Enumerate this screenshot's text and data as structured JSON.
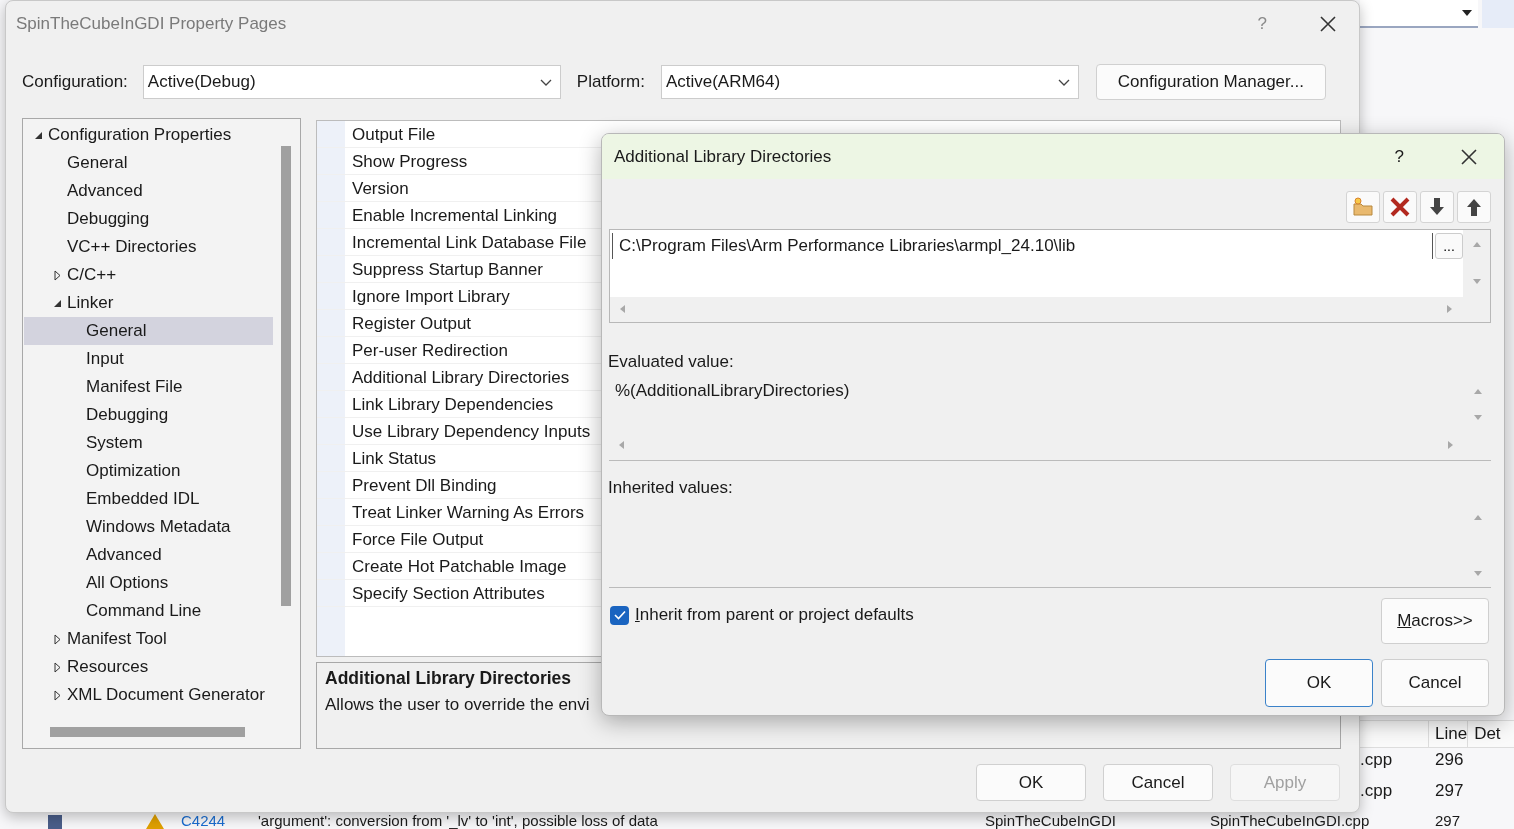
{
  "background_ide": {
    "error_list": {
      "columns": [
        "Line",
        "Det"
      ],
      "rows": [
        {
          "file": ".cpp",
          "line": "296"
        },
        {
          "file": ".cpp",
          "line": "297"
        }
      ]
    },
    "bottom_row": {
      "code": "C4244",
      "description": "'argument': conversion from '_lv' to 'int', possible loss of data",
      "project": "SpinTheCubeInGDI",
      "file": "SpinTheCubeInGDI.cpp",
      "line": "297"
    }
  },
  "window": {
    "title": "SpinTheCubeInGDI Property Pages",
    "help": "?"
  },
  "configuration": {
    "label": "Configuration:",
    "value": "Active(Debug)"
  },
  "platform": {
    "label": "Platform:",
    "value": "Active(ARM64)"
  },
  "configuration_manager_button": "Configuration Manager...",
  "tree": [
    {
      "label": "Configuration Properties",
      "expanded": true,
      "selected": false,
      "children": [
        {
          "label": "General",
          "selected": false
        },
        {
          "label": "Advanced",
          "selected": false
        },
        {
          "label": "Debugging",
          "selected": false
        },
        {
          "label": "VC++ Directories",
          "selected": false
        },
        {
          "label": "C/C++",
          "expanded": false,
          "selected": false
        },
        {
          "label": "Linker",
          "expanded": true,
          "selected": false,
          "children": [
            {
              "label": "General",
              "selected": true
            },
            {
              "label": "Input",
              "selected": false
            },
            {
              "label": "Manifest File",
              "selected": false
            },
            {
              "label": "Debugging",
              "selected": false
            },
            {
              "label": "System",
              "selected": false
            },
            {
              "label": "Optimization",
              "selected": false
            },
            {
              "label": "Embedded IDL",
              "selected": false
            },
            {
              "label": "Windows Metadata",
              "selected": false
            },
            {
              "label": "Advanced",
              "selected": false
            },
            {
              "label": "All Options",
              "selected": false
            },
            {
              "label": "Command Line",
              "selected": false
            }
          ]
        },
        {
          "label": "Manifest Tool",
          "expanded": false,
          "selected": false
        },
        {
          "label": "Resources",
          "expanded": false,
          "selected": false
        },
        {
          "label": "XML Document Generator",
          "expanded": false,
          "selected": false
        }
      ]
    }
  ],
  "properties": [
    "Output File",
    "Show Progress",
    "Version",
    "Enable Incremental Linking",
    "Incremental Link Database File",
    "Suppress Startup Banner",
    "Ignore Import Library",
    "Register Output",
    "Per-user Redirection",
    "Additional Library Directories",
    "Link Library Dependencies",
    "Use Library Dependency Inputs",
    "Link Status",
    "Prevent Dll Binding",
    "Treat Linker Warning As Errors",
    "Force File Output",
    "Create Hot Patchable Image",
    "Specify Section Attributes"
  ],
  "description": {
    "title": "Additional Library Directories",
    "text": "Allows the user to override the envi"
  },
  "buttons": [
    {
      "label": "OK",
      "disabled": false
    },
    {
      "label": "Cancel",
      "disabled": false
    },
    {
      "label": "Apply",
      "disabled": true
    }
  ],
  "dialog": {
    "title": "Additional Library Directories",
    "help": "?",
    "toolbar": [
      {
        "kind": "new-folder"
      },
      {
        "kind": "delete"
      },
      {
        "kind": "down"
      },
      {
        "kind": "up"
      }
    ],
    "directories": [
      "C:\\Program Files\\Arm Performance Libraries\\armpl_24.10\\lib"
    ],
    "browse_button": "...",
    "evaluated_label": "Evaluated value:",
    "evaluated_value": "%(AdditionalLibraryDirectories)",
    "inherited_label": "Inherited values:",
    "inherit_checkbox": {
      "label": "Inherit from parent or project defaults",
      "checked": true
    },
    "macros_button": "Macros>>",
    "buttons": [
      {
        "label": "OK",
        "default": true
      },
      {
        "label": "Cancel",
        "default": false
      }
    ]
  }
}
